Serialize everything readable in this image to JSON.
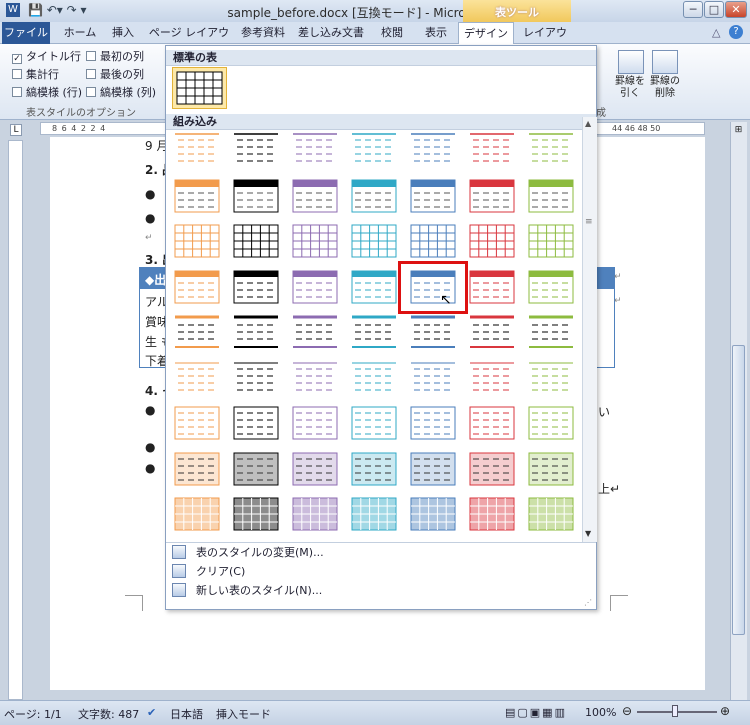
{
  "title": "sample_before.docx [互換モード] - Microsoft Word",
  "table_tools": "表ツール",
  "win_buttons": {
    "min": "─",
    "max": "□",
    "close": "✕"
  },
  "tabs": [
    "ファイル",
    "ホーム",
    "挿入",
    "ページ レイアウト",
    "参考資料",
    "差し込み文書",
    "校閲",
    "表示",
    "デザイン",
    "レイアウト"
  ],
  "style_options": {
    "items": [
      {
        "label": "タイトル行",
        "checked": true
      },
      {
        "label": "最初の列",
        "checked": false
      },
      {
        "label": "集計行",
        "checked": false
      },
      {
        "label": "最後の列",
        "checked": false
      },
      {
        "label": "縞模様 (行)",
        "checked": false
      },
      {
        "label": "縞模様 (列)",
        "checked": false
      }
    ],
    "group_label": "表スタイルのオプション"
  },
  "right_group": {
    "draw": "罫線を\n引く",
    "erase": "罫線の\n削除",
    "suffix": "成"
  },
  "ruler_text": "8 6 4 2   2 4",
  "ruler_right": "44 46 48 50",
  "doc_text": {
    "l1": "9 月",
    "l2": "2. 品",
    "l3": "●",
    "l4": "●",
    "l5": "↵",
    "l6": "3. 出",
    "l7": "◆出",
    "l8": "アル",
    "l9": "賞味",
    "l10": "生 も",
    "l11": "下着",
    "l12": "4. そ",
    "l13": "●",
    "l14": "●",
    "l15": "●",
    "r1": "い",
    "r2": "上↵",
    "r3": "↵",
    "r4": "↵"
  },
  "gallery": {
    "section_standard": "標準の表",
    "section_builtin": "組み込み",
    "colors": [
      "#f29b4c",
      "#222222",
      "#8c6bb1",
      "#2fa8c6",
      "#4a7ebb",
      "#d9363e",
      "#8dbb3f"
    ],
    "selected": {
      "row": 3,
      "col": 4
    }
  },
  "menu": {
    "modify": "表のスタイルの変更(M)...",
    "clear": "クリア(C)",
    "new": "新しい表のスタイル(N)..."
  },
  "status": {
    "page": "ページ: 1/1",
    "words": "文字数: 487",
    "lang": "日本語",
    "mode": "挿入モード",
    "zoom": "100%"
  }
}
